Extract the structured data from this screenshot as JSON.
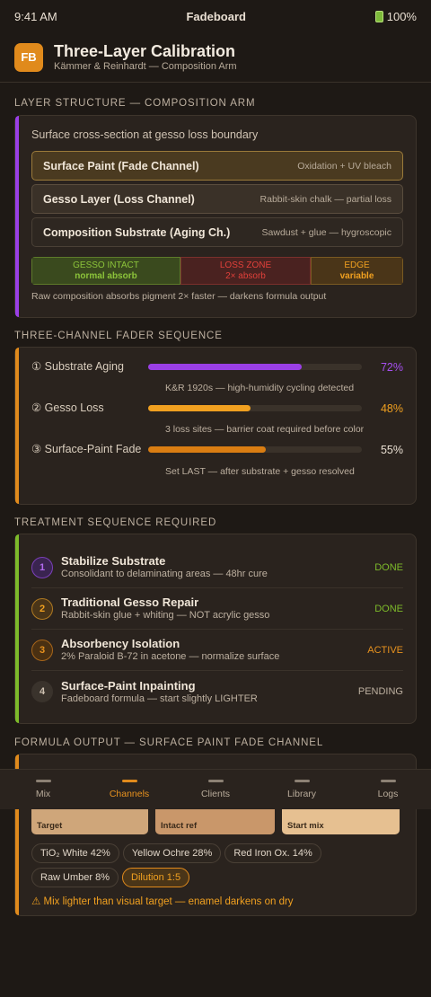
{
  "status": {
    "time": "9:41 AM",
    "app": "Fadeboard",
    "battery": "100%"
  },
  "header": {
    "logo": "FB",
    "title": "Three-Layer Calibration",
    "subtitle": "Kämmer & Reinhardt — Composition Arm"
  },
  "layers": {
    "heading": "Layer Structure — Composition Arm",
    "caption": "Surface cross-section at gesso loss boundary",
    "items": [
      {
        "name": "Surface Paint (Fade Channel)",
        "desc": "Oxidation + UV bleach"
      },
      {
        "name": "Gesso Layer (Loss Channel)",
        "desc": "Rabbit-skin chalk — partial loss"
      },
      {
        "name": "Composition Substrate (Aging Ch.)",
        "desc": "Sawdust + glue — hygroscopic"
      }
    ],
    "zones": [
      {
        "title": "Gesso Intact",
        "sub": "normal absorb"
      },
      {
        "title": "Loss Zone",
        "sub": "2× absorb"
      },
      {
        "title": "Edge",
        "sub": "variable"
      }
    ],
    "note": "Raw composition absorbs pigment 2× faster — darkens formula output"
  },
  "faders": {
    "heading": "Three-Channel Fader Sequence",
    "items": [
      {
        "label": "① Substrate Aging",
        "value": "72%",
        "level": 0.72,
        "color": "#9a3fe6",
        "note": "K&R 1920s — high-humidity cycling detected"
      },
      {
        "label": "② Gesso Loss",
        "value": "48%",
        "level": 0.48,
        "color": "#f0a020",
        "note": "3 loss sites — barrier coat required before color"
      },
      {
        "label": "③ Surface-Paint Fade",
        "value": "55%",
        "level": 0.55,
        "color": "#d97d12",
        "note": "Set LAST — after substrate + gesso resolved"
      }
    ]
  },
  "treatment": {
    "heading": "Treatment Sequence Required",
    "steps": [
      {
        "num": "1",
        "title": "Stabilize Substrate",
        "desc": "Consolidant to delaminating areas — 48hr cure",
        "status": "DONE"
      },
      {
        "num": "2",
        "title": "Traditional Gesso Repair",
        "desc": "Rabbit-skin glue + whiting — NOT acrylic gesso",
        "status": "DONE"
      },
      {
        "num": "3",
        "title": "Absorbency Isolation",
        "desc": "2% Paraloid B-72 in acetone — normalize surface",
        "status": "ACTIVE"
      },
      {
        "num": "4",
        "title": "Surface-Paint Inpainting",
        "desc": "Fadeboard formula — start slightly LIGHTER",
        "status": "PENDING"
      }
    ]
  },
  "formula": {
    "heading": "Formula Output — Surface Paint Fade Channel",
    "swatches": [
      {
        "label": "Target",
        "color": "#cfa67a"
      },
      {
        "label": "Intact ref",
        "color": "#c9976a"
      },
      {
        "label": "Start mix",
        "color": "#e6c091"
      }
    ],
    "chips": [
      "TiO₂ White 42%",
      "Yellow Ochre 28%",
      "Red Iron Ox. 14%",
      "Raw Umber 8%"
    ],
    "dilution": "Dilution 1:5",
    "warning": "⚠ Mix lighter than visual target — enamel darkens on dry"
  },
  "tabs": [
    {
      "label": "Mix",
      "active": false
    },
    {
      "label": "Channels",
      "active": true
    },
    {
      "label": "Clients",
      "active": false
    },
    {
      "label": "Library",
      "active": false
    },
    {
      "label": "Logs",
      "active": false
    }
  ],
  "colors": {
    "accent": "#e08a1c",
    "purple": "#9a3fe6",
    "green": "#7dba2a",
    "red": "#e0403a"
  }
}
